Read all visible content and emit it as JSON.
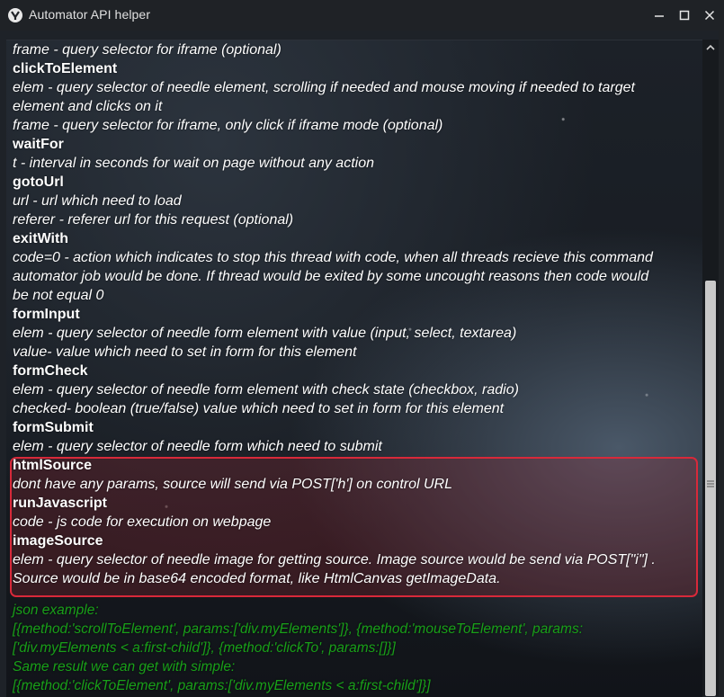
{
  "window": {
    "title": "Automator API helper",
    "icons": {
      "app": "automator-logo-icon",
      "minimize": "minimize-icon",
      "maximize": "maximize-icon",
      "close": "close-icon"
    }
  },
  "doc": {
    "lines": [
      {
        "kind": "param",
        "text": "frame - query selector for iframe (optional)"
      },
      {
        "kind": "method",
        "text": "clickToElement"
      },
      {
        "kind": "param",
        "text": "elem - query selector of needle element, scrolling if needed and mouse moving if needed to target"
      },
      {
        "kind": "param",
        "text": "element and clicks on it"
      },
      {
        "kind": "param",
        "text": "frame - query selector for iframe, only click if iframe mode (optional)"
      },
      {
        "kind": "method",
        "text": "waitFor"
      },
      {
        "kind": "param",
        "text": "t - interval in seconds for wait on page without any action"
      },
      {
        "kind": "method",
        "text": "gotoUrl"
      },
      {
        "kind": "param",
        "text": "url - url which need to load"
      },
      {
        "kind": "param",
        "text": "referer - referer url for this request (optional)"
      },
      {
        "kind": "method",
        "text": "exitWith"
      },
      {
        "kind": "param",
        "text": "code=0 - action which indicates to stop this thread with code, when all threads recieve this command"
      },
      {
        "kind": "param",
        "text": "automator job would be done. If thread would be exited by some uncought reasons then code would"
      },
      {
        "kind": "param",
        "text": "be not equal 0"
      },
      {
        "kind": "method",
        "text": "formInput"
      },
      {
        "kind": "param",
        "text": "elem - query selector of needle form element with value (input, select, textarea)"
      },
      {
        "kind": "param",
        "text": "value- value which need to set in form for this element"
      },
      {
        "kind": "method",
        "text": "formCheck"
      },
      {
        "kind": "param",
        "text": "elem - query selector of needle form element with check state (checkbox, radio)"
      },
      {
        "kind": "param",
        "text": "checked- boolean (true/false) value which need to set in form for this element"
      },
      {
        "kind": "method",
        "text": "formSubmit"
      },
      {
        "kind": "param",
        "text": "elem - query selector of needle form which need to submit"
      },
      {
        "kind": "method",
        "text": "htmlSource"
      },
      {
        "kind": "param",
        "text": "dont have any params, source will send via POST['h'] on control URL"
      },
      {
        "kind": "method",
        "text": "runJavascript"
      },
      {
        "kind": "param",
        "text": "code - js code for execution on webpage"
      },
      {
        "kind": "method",
        "text": "imageSource"
      },
      {
        "kind": "param",
        "text": "elem - query selector of needle image for getting source. Image source would be send via POST[\"i\"] ."
      },
      {
        "kind": "param",
        "text": "Source would be in base64 encoded format, like HtmlCanvas getImageData."
      }
    ],
    "json_example": [
      "json example:",
      "[{method:'scrollToElement', params:['div.myElements']}, {method:'mouseToElement', params:",
      "['div.myElements < a:first-child']}, {method:'clickTo', params:[]}]",
      "Same result we can get with simple:",
      "[{method:'clickToElement', params:['div.myElements < a:first-child']}]"
    ]
  },
  "colors": {
    "json_text": "#19a019",
    "highlight_border": "#d8293a"
  },
  "scrollbar": {
    "up_icon": "scroll-up-arrow-icon",
    "grip_icon": "scroll-grip-icon"
  }
}
